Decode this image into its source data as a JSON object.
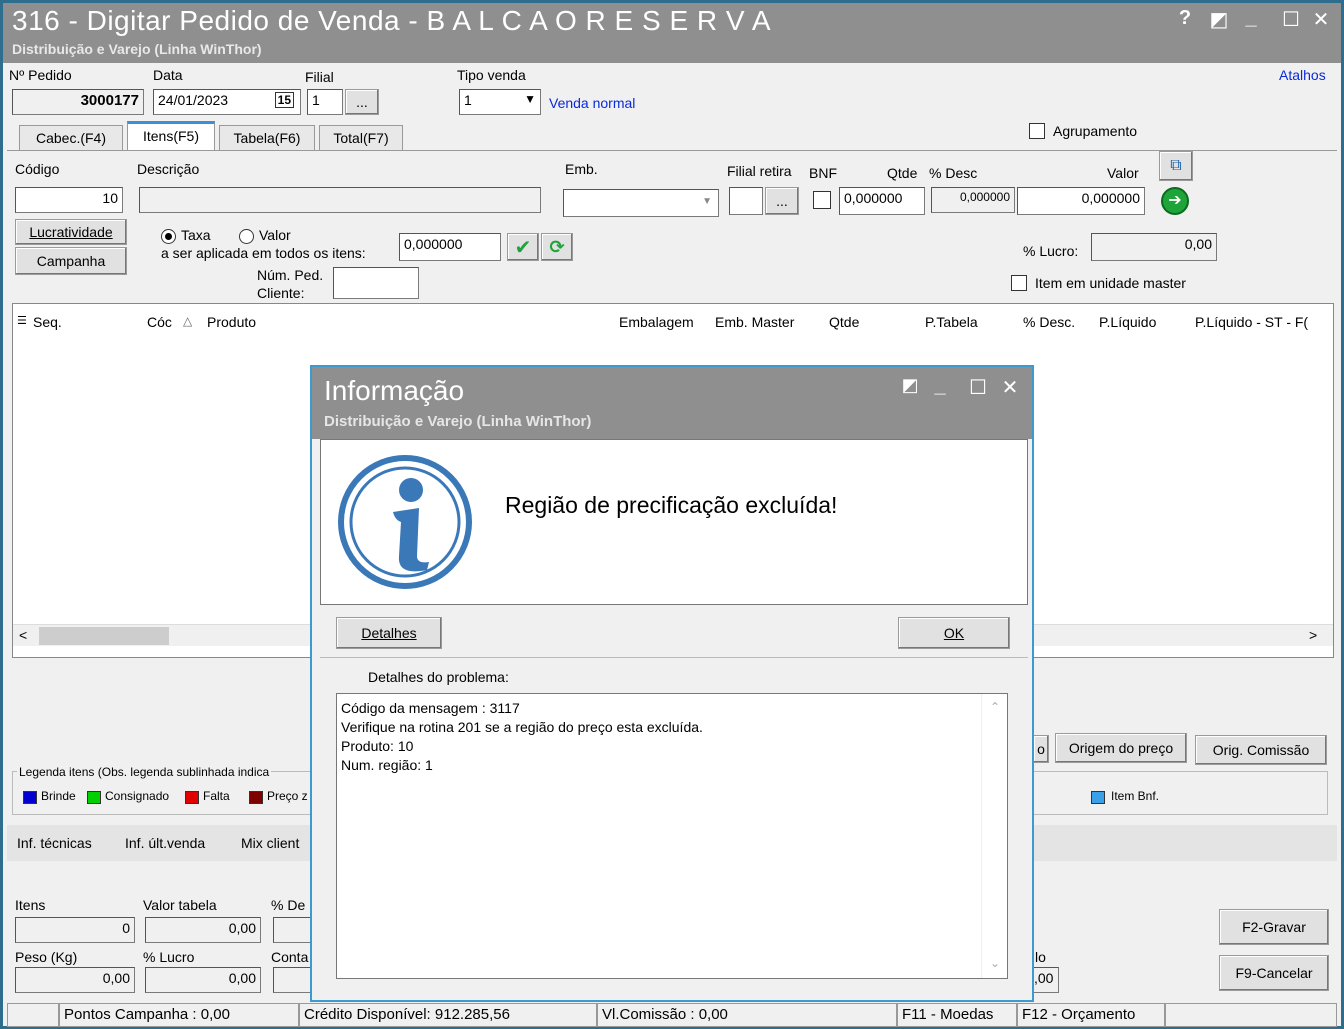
{
  "window": {
    "title": "316 - Digitar Pedido de Venda - B A L C A O  R E S E R V A",
    "subtitle": "Distribuição e Varejo (Linha WinThor)",
    "controls": [
      "?",
      "◩",
      "_",
      "☐",
      "✕"
    ]
  },
  "header": {
    "pedido_label": "Nº Pedido",
    "pedido_value": "3000177",
    "data_label": "Data",
    "data_value": "24/01/2023",
    "filial_label": "Filial",
    "filial_value": "1",
    "filial_btn": "...",
    "tipo_label": "Tipo venda",
    "tipo_value": "1",
    "tipo_desc": "Venda normal",
    "atalhos": "Atalhos"
  },
  "tabs": [
    "Cabec.(F4)",
    "Itens(F5)",
    "Tabela(F6)",
    "Total(F7)"
  ],
  "agrupamento": "Agrupamento",
  "item_form": {
    "codigo_label": "Código",
    "codigo_value": "10",
    "descricao_label": "Descrição",
    "emb_label": "Emb.",
    "filial_retira_label": "Filial retira",
    "filial_retira_btn": "...",
    "bnf_label": "BNF",
    "qtde_label": "Qtde",
    "qtde_value": "0,000000",
    "desc_label": "% Desc",
    "desc_value": "0,000000",
    "valor_label": "Valor",
    "valor_value": "0,000000",
    "lucratividade_btn": "Lucratividade",
    "campanha_btn": "Campanha",
    "taxa_label": "Taxa",
    "valor_radio_label": "Valor",
    "aplicada_label": "a ser aplicada em todos os itens:",
    "aplicada_value": "0,000000",
    "num_ped_label1": "Núm. Ped.",
    "num_ped_label2": "Cliente:",
    "lucro_label": "% Lucro:",
    "lucro_value": "0,00",
    "item_master_label": "Item em unidade master"
  },
  "grid": {
    "columns": [
      "Seq.",
      "Cóc",
      "Produto",
      "Embalagem",
      "Emb. Master",
      "Qtde",
      "P.Tabela",
      "% Desc.",
      "P.Líquido",
      "P.Líquido - ST - F("
    ]
  },
  "buttons_mid": {
    "partial": "o",
    "origem": "Origem do preço",
    "orig_comissao": "Orig. Comissão"
  },
  "legend": {
    "title": "Legenda itens (Obs. legenda sublinhada indica",
    "items": [
      {
        "label": "Brinde",
        "color": "#0000d0"
      },
      {
        "label": "Consignado",
        "color": "#00d000"
      },
      {
        "label": "Falta",
        "color": "#e00000"
      },
      {
        "label": "Preço z",
        "color": "#800000"
      }
    ],
    "item_bnf": {
      "label": "Item Bnf.",
      "color": "#3aa0e8"
    }
  },
  "bottom_tabs": [
    "Inf. técnicas",
    "Inf. últ.venda",
    "Mix client"
  ],
  "totals": {
    "itens_label": "Itens",
    "itens_value": "0",
    "valor_tabela_label": "Valor tabela",
    "valor_tabela_value": "0,00",
    "desc_label": "% De",
    "peso_label": "Peso (Kg)",
    "peso_value": "0,00",
    "lucro_label": "% Lucro",
    "lucro_value": "0,00",
    "conta_label": "Conta",
    "partial_label": "lo",
    "partial_value": ",00"
  },
  "actions": {
    "gravar": "F2-Gravar",
    "cancelar": "F9-Cancelar"
  },
  "statusbar": {
    "pontos": "Pontos Campanha : 0,00",
    "credito": "Crédito Disponível: 912.285,56",
    "comissao": "Vl.Comissão : 0,00",
    "moedas": "F11 - Moedas",
    "orcamento": "F12 - Orçamento"
  },
  "dialog": {
    "title": "Informação",
    "subtitle": "Distribuição e Varejo (Linha WinThor)",
    "message": "Região de precificação excluída!",
    "detalhes_btn": "Detalhes",
    "ok_btn": "OK",
    "detalhes_label": "Detalhes do problema:",
    "details": [
      "Código da mensagem : 3117",
      "Verifique na rotina 201 se a região do preço esta excluída.",
      "Produto: 10",
      "Num. região: 1"
    ]
  }
}
